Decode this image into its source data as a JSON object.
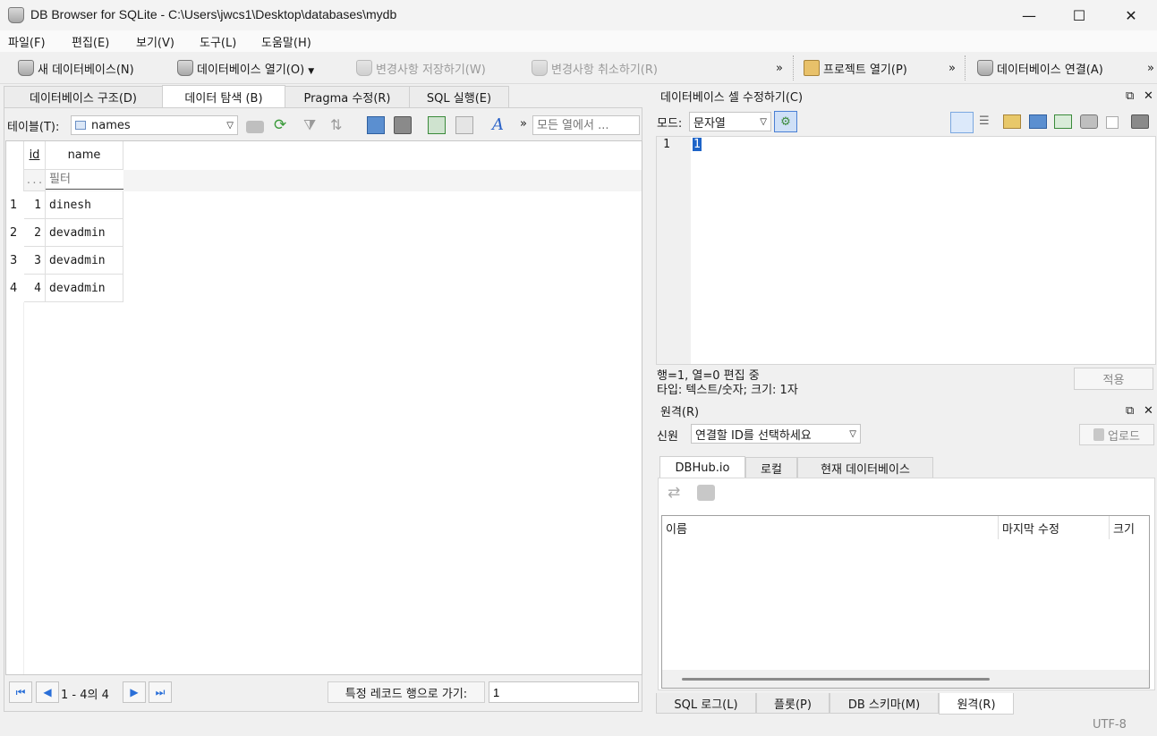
{
  "window": {
    "title": "DB Browser for SQLite - C:\\Users\\jwcs1\\Desktop\\databases\\mydb",
    "minimize": "—",
    "maximize": "☐",
    "close": "✕"
  },
  "menu": [
    "파일(F)",
    "편집(E)",
    "보기(V)",
    "도구(L)",
    "도움말(H)"
  ],
  "toolbar": {
    "new_db": "새 데이터베이스(N)",
    "open_db": "데이터베이스 열기(O)",
    "write_changes": "변경사항 저장하기(W)",
    "revert_changes": "변경사항 취소하기(R)",
    "overflow": "»",
    "open_project": "프로젝트 열기(P)",
    "attach_db": "데이터베이스 연결(A)"
  },
  "main_tabs": [
    "데이터베이스 구조(D)",
    "데이터 탐색 (B)",
    "Pragma 수정(R)",
    "SQL 실행(E)"
  ],
  "browse": {
    "table_label": "테이블(T):",
    "table_value": "names",
    "filter_all_placeholder": "모든 열에서 ...",
    "overflow": "»",
    "columns": [
      "id",
      "name"
    ],
    "filter_hint": "...",
    "filter_placeholder": "필터",
    "rows": [
      {
        "rownum": "1",
        "id": "1",
        "name": "dinesh"
      },
      {
        "rownum": "2",
        "id": "2",
        "name": "devadmin"
      },
      {
        "rownum": "3",
        "id": "3",
        "name": "devadmin"
      },
      {
        "rownum": "4",
        "id": "4",
        "name": "devadmin"
      }
    ],
    "range_text": "1 - 4의 4",
    "goto_label": "특정 레코드 행으로 가기:",
    "goto_value": "1"
  },
  "edit_cell": {
    "title": "데이터베이스 셀 수정하기(C)",
    "mode_label": "모드:",
    "mode_value": "문자열",
    "line_number": "1",
    "cell_value": "1",
    "status_line1": "행=1, 열=0 편집 중",
    "status_line2": "타입: 텍스트/숫자; 크기: 1자",
    "apply": "적용"
  },
  "remote": {
    "title": "원격(R)",
    "identity_label": "신원",
    "identity_value": "연결할 ID를 선택하세요",
    "upload": "업로드",
    "tabs": [
      "DBHub.io",
      "로컬",
      "현재 데이터베이스"
    ],
    "columns": [
      "이름",
      "마지막 수정",
      "크기"
    ]
  },
  "bottom_tabs": [
    "SQL 로그(L)",
    "플롯(P)",
    "DB 스키마(M)",
    "원격(R)"
  ],
  "status": {
    "encoding": "UTF-8"
  }
}
